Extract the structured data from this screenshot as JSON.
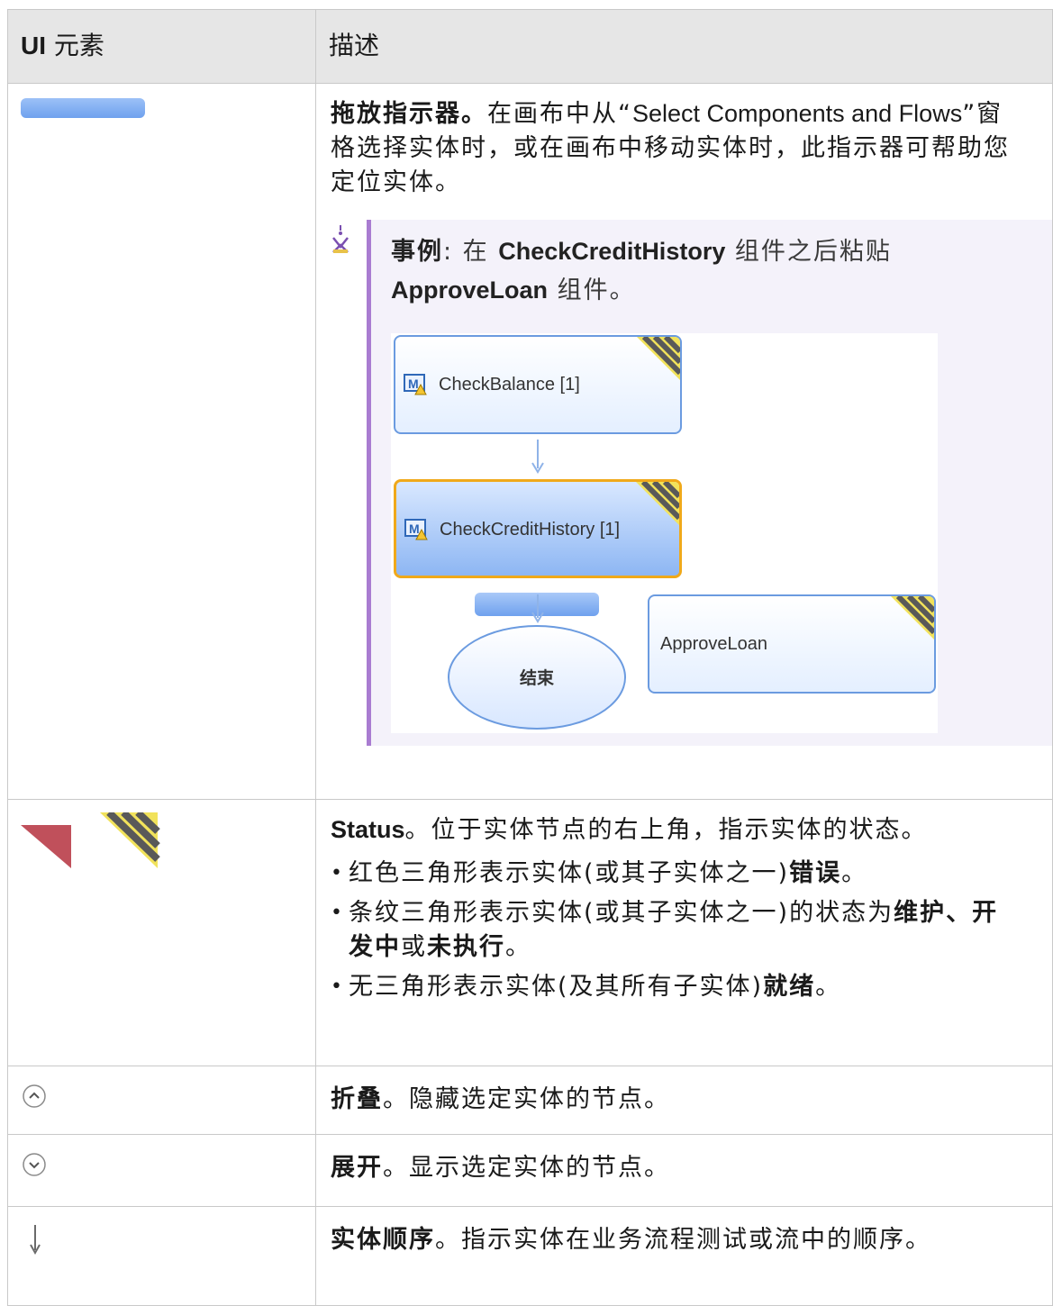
{
  "header": {
    "col1_prefix": "UI",
    "col1_suffix": " 元素",
    "col2": "描述"
  },
  "rows": {
    "drop": {
      "title": "拖放指示器。",
      "desc_pre": "在画布中从“",
      "desc_latin": "Select Components and Flows",
      "desc_post": "”窗格选择实体时，或在画布中移动实体时，此指示器可帮助您定位实体。",
      "note_label": "事例",
      "note_sep": ": 在 ",
      "note_c1": "CheckCreditHistory",
      "note_mid": " 组件之后粘贴 ",
      "note_c2": "ApproveLoan",
      "note_end": " 组件。",
      "diagram": {
        "node1": "CheckBalance [1]",
        "node2": "CheckCreditHistory [1]",
        "node3": "ApproveLoan",
        "end": "结束"
      }
    },
    "status": {
      "title": "Status",
      "desc": "。位于实体节点的右上角，指示实体的状态。",
      "li1_pre": "红色三角形表示实体(或其子实体之一)",
      "li1_b": "错误",
      "li1_post": "。",
      "li2_pre": "条纹三角形表示实体(或其子实体之一)的状态为",
      "li2_b1": "维护",
      "li2_s1": "、",
      "li2_b2": "开发中",
      "li2_s2": "或",
      "li2_b3": "未执行",
      "li2_post": "。",
      "li3_pre": "无三角形表示实体(及其所有子实体)",
      "li3_b": "就绪",
      "li3_post": "。",
      "error_color": "#c0505b"
    },
    "collapse": {
      "title": "折叠",
      "desc": "。隐藏选定实体的节点。"
    },
    "expand": {
      "title": "展开",
      "desc": "。显示选定实体的节点。"
    },
    "order": {
      "title": "实体顺序",
      "desc": "。指示实体在业务流程测试或流中的顺序。"
    }
  }
}
